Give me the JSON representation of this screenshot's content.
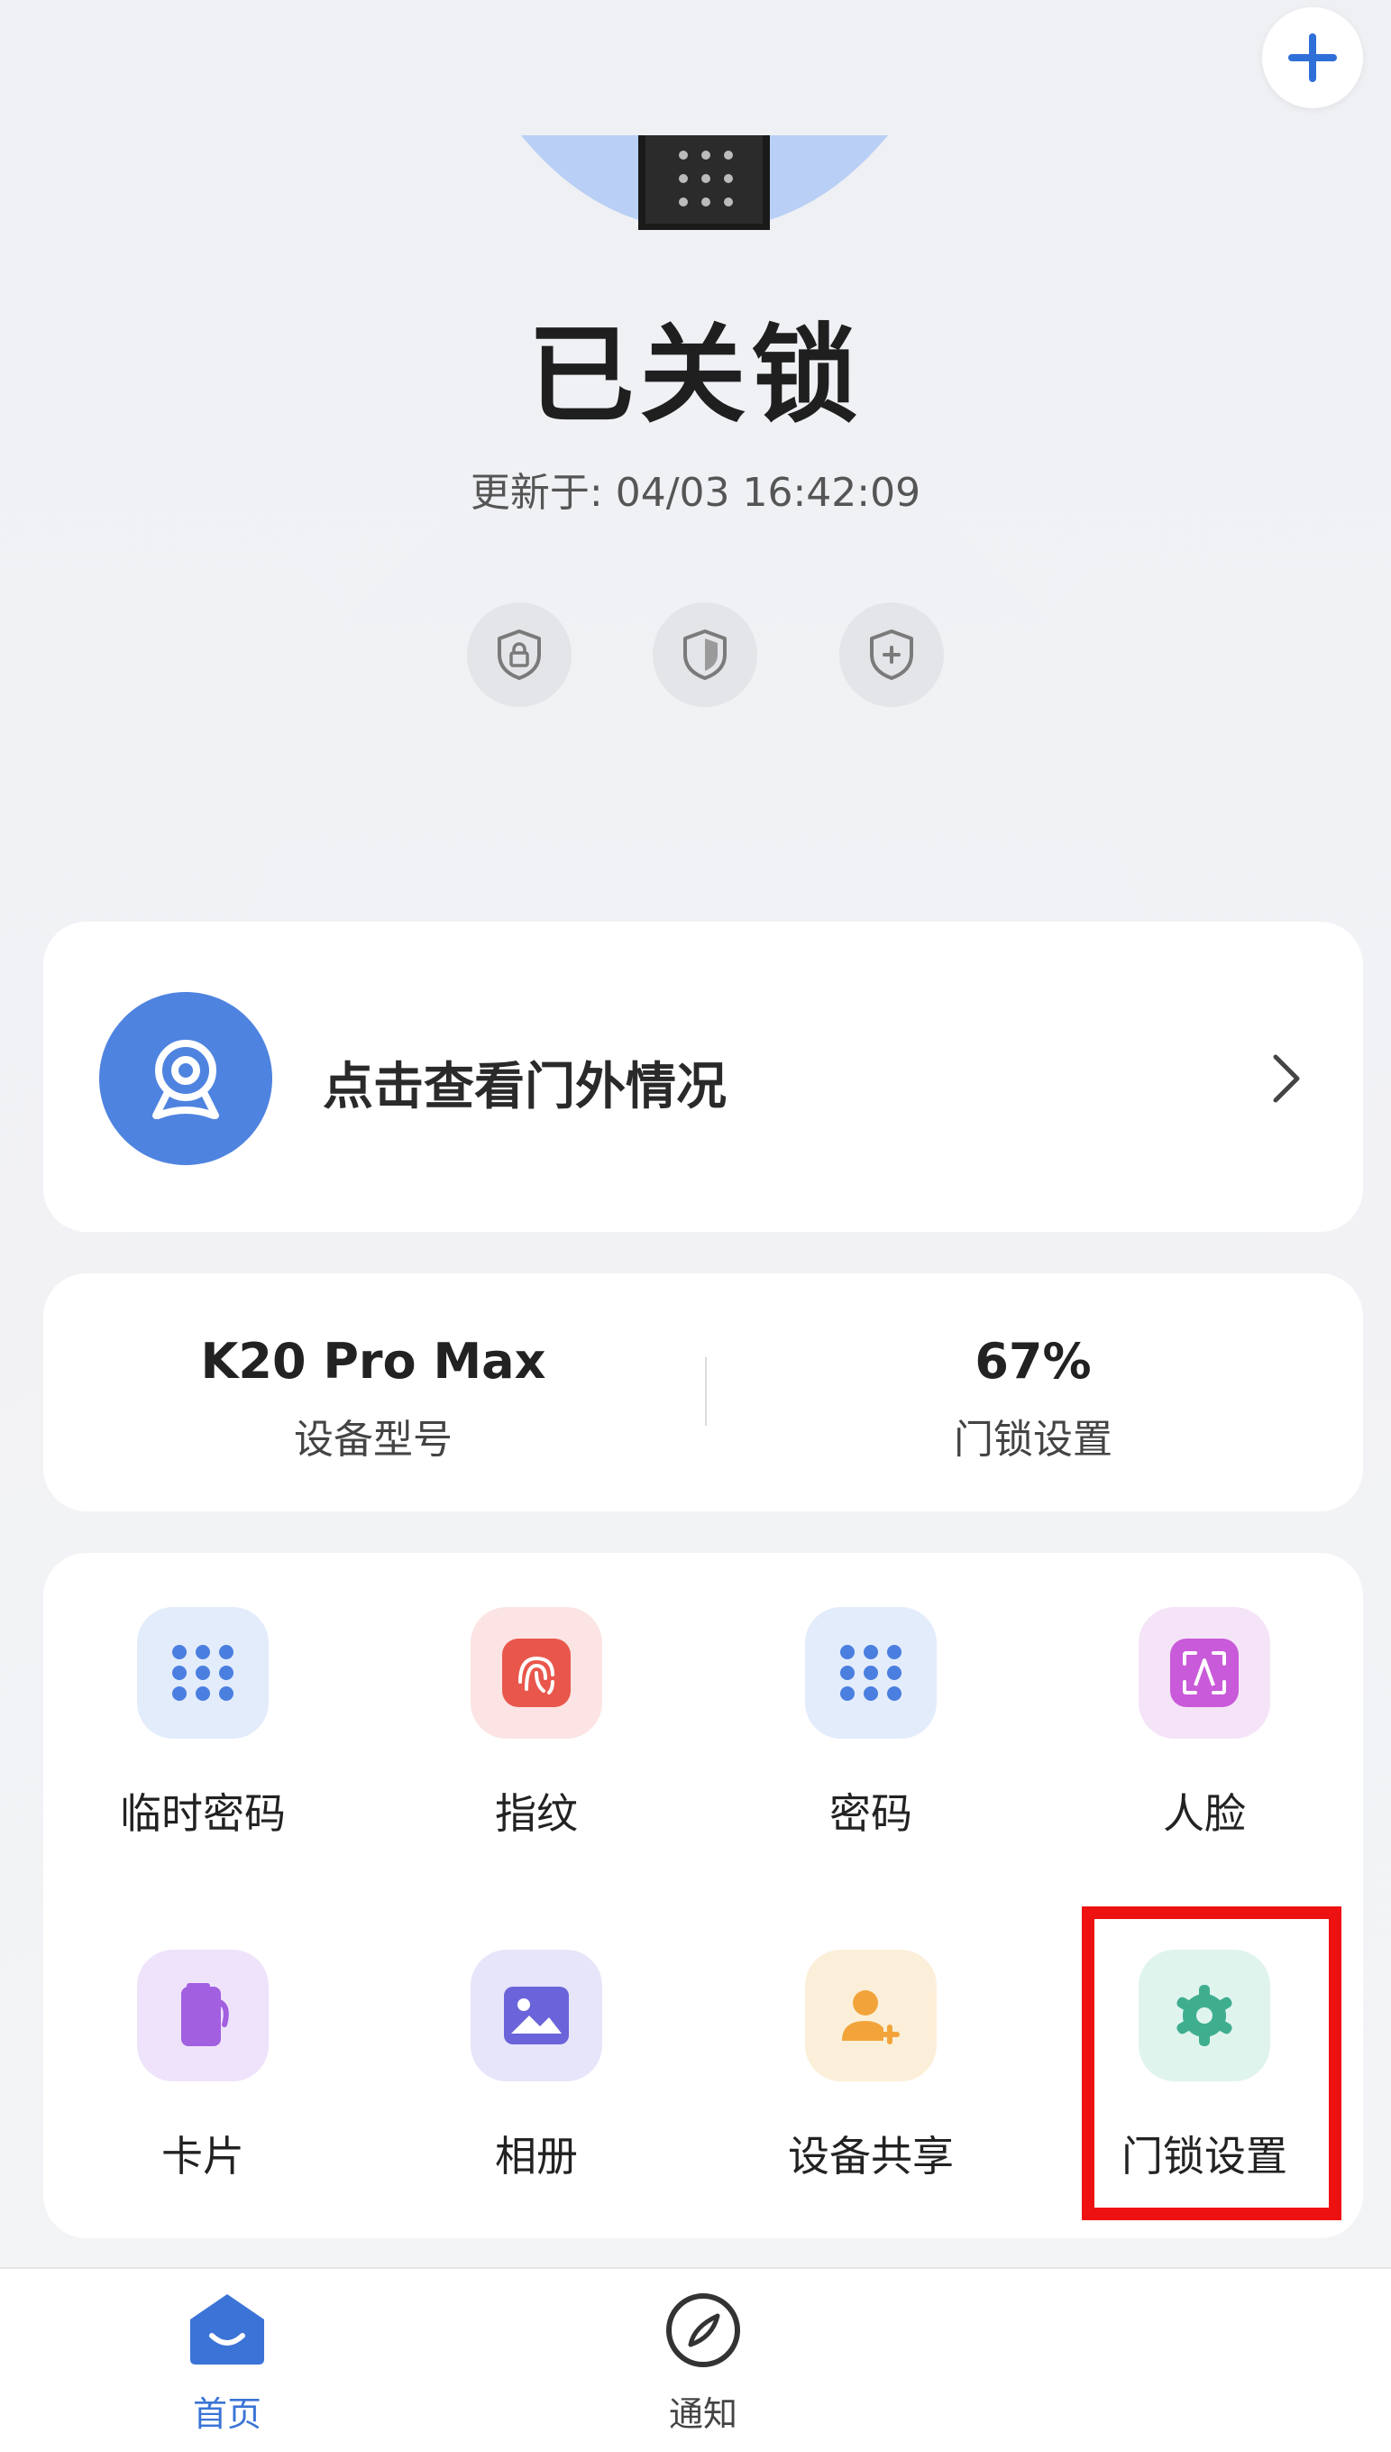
{
  "header": {
    "add_icon": "plus-icon",
    "lock_status": "已关锁",
    "update_label": "更新于:",
    "update_time": "04/03 16:42:09"
  },
  "mode_icons": [
    "shield-lock-icon",
    "shield-icon",
    "shield-plus-icon"
  ],
  "camera_card": {
    "text": "点击查看门外情况",
    "icon": "camera-icon"
  },
  "info": {
    "model_value": "K20 Pro Max",
    "model_label": "设备型号",
    "battery_value": "67%",
    "battery_label": "门锁设置"
  },
  "grid": [
    {
      "label": "临时密码",
      "icon": "keypad-icon"
    },
    {
      "label": "指纹",
      "icon": "fingerprint-icon"
    },
    {
      "label": "密码",
      "icon": "keypad-icon"
    },
    {
      "label": "人脸",
      "icon": "face-icon"
    },
    {
      "label": "卡片",
      "icon": "card-icon"
    },
    {
      "label": "相册",
      "icon": "photo-icon"
    },
    {
      "label": "设备共享",
      "icon": "user-add-icon"
    },
    {
      "label": "门锁设置",
      "icon": "gear-icon"
    }
  ],
  "tabs": [
    {
      "label": "首页",
      "icon": "home-icon",
      "active": true
    },
    {
      "label": "通知",
      "icon": "compass-icon",
      "active": false
    }
  ],
  "colors": {
    "accent": "#3b74d6",
    "highlight": "#ee1111"
  }
}
